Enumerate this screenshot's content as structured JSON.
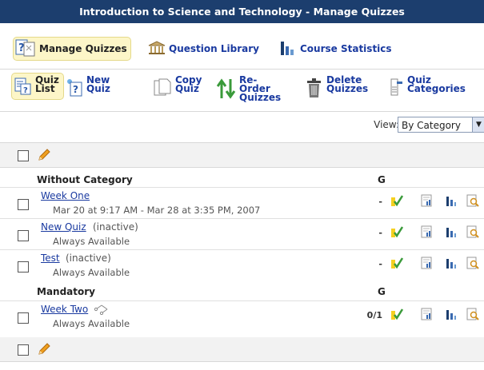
{
  "title": "Introduction to Science and Technology - Manage Quizzes",
  "nav": {
    "manage": "Manage Quizzes",
    "library": "Question Library",
    "stats": "Course Statistics"
  },
  "toolbar": {
    "quiz_list": [
      "Quiz",
      "List"
    ],
    "new_quiz": [
      "New",
      "Quiz"
    ],
    "copy_quiz": [
      "Copy",
      "Quiz"
    ],
    "reorder": [
      "Re-",
      "Order",
      "Quizzes"
    ],
    "delete": [
      "Delete",
      "Quizzes"
    ],
    "categories": [
      "Quiz",
      "Categories"
    ]
  },
  "view": {
    "label": "View:",
    "selected": "By Category"
  },
  "grade_header": "G",
  "categories": [
    {
      "name": "Without Category",
      "quizzes": [
        {
          "name": "Week One",
          "note": "",
          "availability": "Mar 20 at 9:17 AM - Mar 28 at 3:35 PM, 2007",
          "grade": "-"
        },
        {
          "name": "New Quiz",
          "note": "(inactive)",
          "availability": "Always Available",
          "grade": "-"
        },
        {
          "name": "Test",
          "note": "(inactive)",
          "availability": "Always Available",
          "grade": "-"
        }
      ]
    },
    {
      "name": "Mandatory",
      "quizzes": [
        {
          "name": "Week Two",
          "note": "",
          "availability": "Always Available",
          "grade": "0/1"
        }
      ]
    }
  ],
  "colors": {
    "title_bg": "#1c3e6e",
    "link": "#1a3aa0",
    "active_bg": "#fdf6c8"
  }
}
